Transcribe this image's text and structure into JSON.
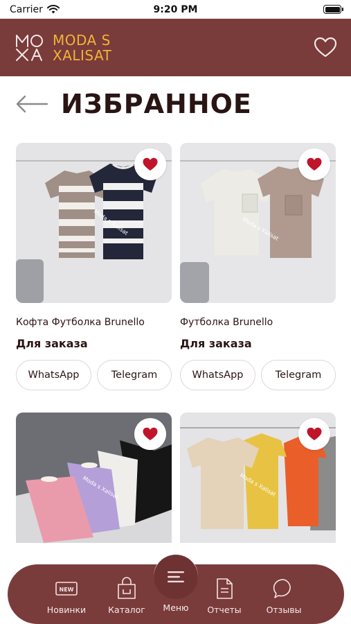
{
  "status_bar": {
    "carrier": "Carrier",
    "time": "9:20 PM"
  },
  "header": {
    "brand_line1": "MODA S",
    "brand_line2": "XALISAT",
    "brand_mark": "MO XA"
  },
  "page": {
    "title": "ИЗБРАННОЕ"
  },
  "products": [
    {
      "name": "Кофта Футболка Brunello",
      "order_label": "Для заказа",
      "whatsapp_label": "WhatsApp",
      "telegram_label": "Telegram",
      "watermark": "Moda s Xalisat"
    },
    {
      "name": "Футболка Brunello",
      "order_label": "Для заказа",
      "whatsapp_label": "WhatsApp",
      "telegram_label": "Telegram",
      "watermark": "Moda s Xalisat"
    },
    {
      "watermark": "Moda s Xalisat"
    },
    {
      "watermark": "Moda s Xalisat"
    }
  ],
  "nav": {
    "new_badge": "NEW",
    "items": [
      {
        "label": "Новинки",
        "icon": "new-badge-icon"
      },
      {
        "label": "Каталог",
        "icon": "shopping-bag-icon"
      },
      {
        "label": "Меню",
        "icon": "menu-icon"
      },
      {
        "label": "Отчеты",
        "icon": "document-icon"
      },
      {
        "label": "Отзывы",
        "icon": "chat-bubble-icon"
      }
    ]
  },
  "colors": {
    "brand": "#7a3b3b",
    "accent_gold": "#f0b43a",
    "heart_red": "#c0142a"
  }
}
